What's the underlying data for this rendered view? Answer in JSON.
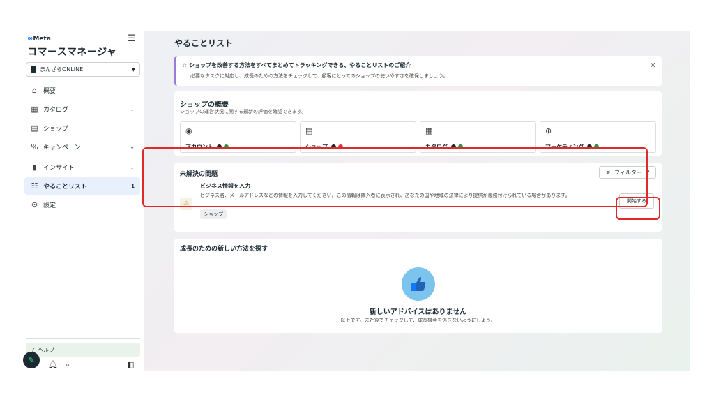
{
  "sidebar": {
    "brand": "Meta",
    "app_title": "コマースマネージャ",
    "shop_name": "まんざらONLINE",
    "items": [
      {
        "label": "概要"
      },
      {
        "label": "カタログ"
      },
      {
        "label": "ショップ"
      },
      {
        "label": "キャンペーン"
      },
      {
        "label": "インサイト"
      },
      {
        "label": "やることリスト",
        "badge": "1"
      },
      {
        "label": "設定"
      }
    ],
    "help": "ヘルプ"
  },
  "main": {
    "page_title": "やることリスト",
    "banner": {
      "title": "ショップを改善する方法をすべてまとめてトラッキングできる、やることリストのご紹介",
      "text": "必要なタスクに対応し、成長のための方法をチェックして、顧客にとってのショップの使いやすさを確保しましょう。"
    },
    "overview": {
      "title": "ショップの概要",
      "subtitle": "ショップの運営状況に関する最新の評価を確認できます。",
      "tiles": [
        {
          "label": "アカウント",
          "status_color": "#1a9b45"
        },
        {
          "label": "ショップ",
          "status_color": "#e0323a"
        },
        {
          "label": "カタログ",
          "status_color": "#1a9b45"
        },
        {
          "label": "マーケティング",
          "status_color": "#1a9b45"
        }
      ]
    },
    "issues": {
      "title": "未解決の問題",
      "filter_label": "フィルター",
      "item": {
        "title": "ビジネス情報を入力",
        "description": "ビジネス名、メールアドレスなどの情報を入力してください。この情報は購入者に表示され、あなたの国や地域の法律により提供が義務付けられている場合があります。",
        "tag": "ショップ",
        "button": "開始する"
      }
    },
    "growth": {
      "title": "成長のための新しい方法を探す",
      "empty_title": "新しいアドバイスはありません",
      "empty_text": "以上です。また後でチェックして、成長機会を逃さないようにしよう。"
    }
  },
  "colors": {
    "accent": "#0866ff",
    "highlight": "#e02a2a",
    "banner_border": "#9b7bd8"
  }
}
